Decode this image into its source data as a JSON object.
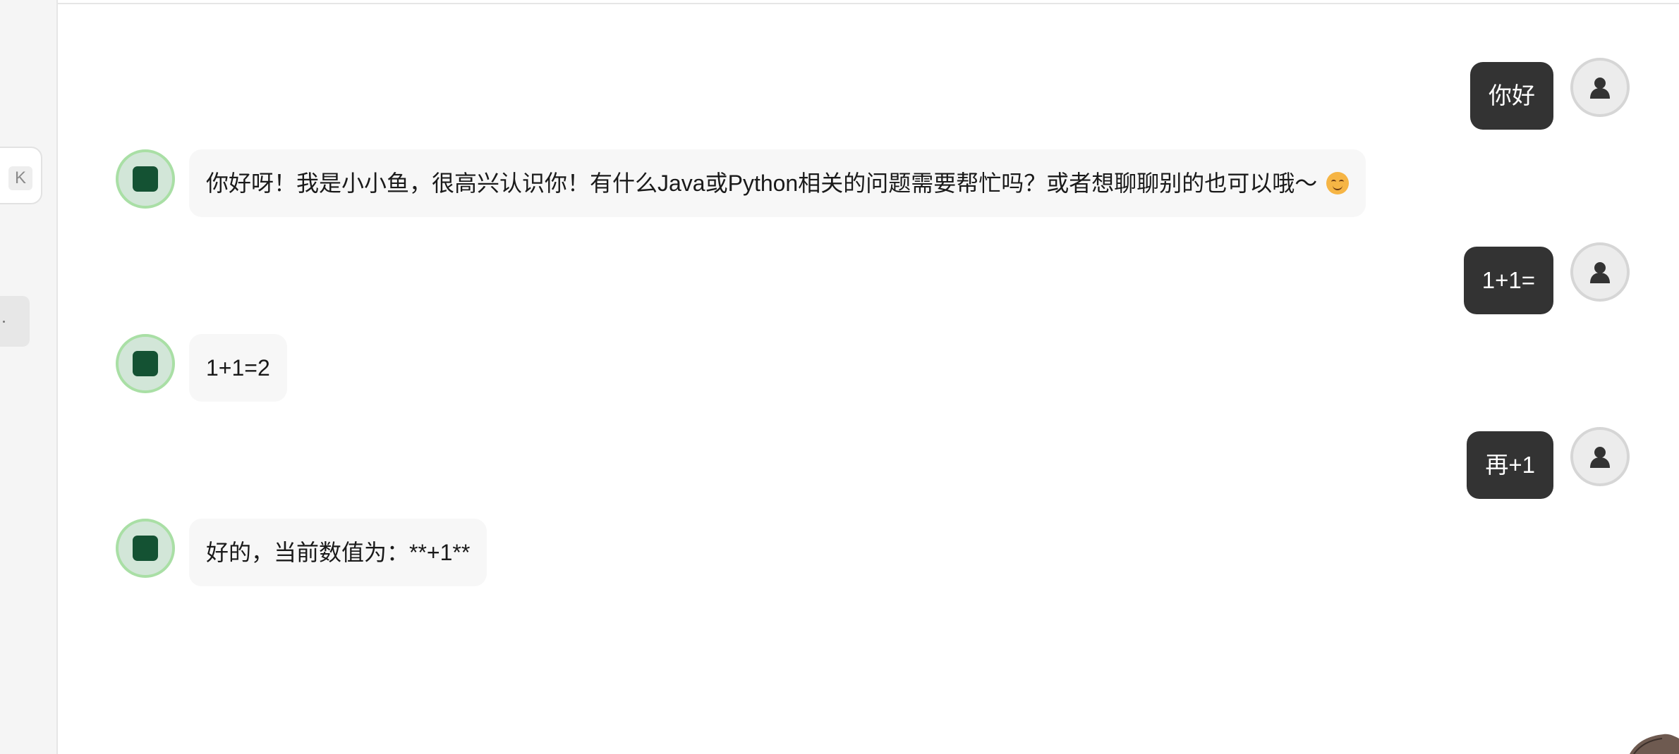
{
  "sidebar": {
    "shortcut_key": "K"
  },
  "messages": [
    {
      "role": "user",
      "text": "你好"
    },
    {
      "role": "assistant",
      "text": "你好呀！我是小小鱼，很高兴认识你！有什么Java或Python相关的问题需要帮忙吗？或者想聊聊别的也可以哦～",
      "emoji": "smiling-face-emoji"
    },
    {
      "role": "user",
      "text": "1+1="
    },
    {
      "role": "assistant",
      "text": "1+1=2"
    },
    {
      "role": "user",
      "text": "再+1"
    },
    {
      "role": "assistant",
      "text": "好的，当前数值为：**+1**"
    }
  ],
  "colors": {
    "user_bubble": "#333333",
    "bot_bubble": "#f7f7f7",
    "bot_avatar_ring": "#a9dfa5",
    "bot_avatar_mark": "#145233"
  },
  "icons": {
    "user_avatar": "person-icon",
    "bot_avatar": "green-square-icon"
  }
}
